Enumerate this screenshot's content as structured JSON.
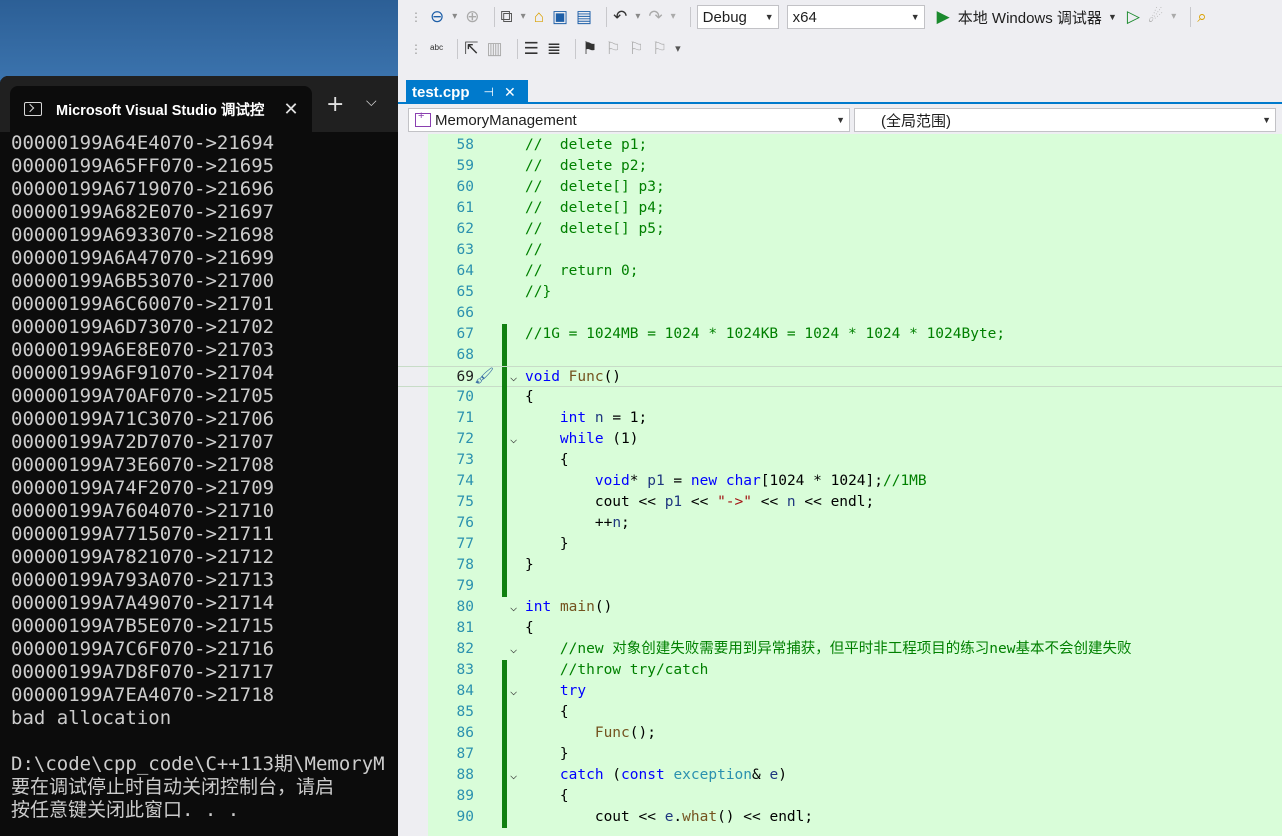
{
  "console": {
    "tab_title": "Microsoft Visual Studio 调试控",
    "new_tab_label": "+",
    "dropdown_label": "⌵",
    "close_label": "✕",
    "lines": [
      "00000199A64E4070->21694",
      "00000199A65FF070->21695",
      "00000199A6719070->21696",
      "00000199A682E070->21697",
      "00000199A6933070->21698",
      "00000199A6A47070->21699",
      "00000199A6B53070->21700",
      "00000199A6C60070->21701",
      "00000199A6D73070->21702",
      "00000199A6E8E070->21703",
      "00000199A6F91070->21704",
      "00000199A70AF070->21705",
      "00000199A71C3070->21706",
      "00000199A72D7070->21707",
      "00000199A73E6070->21708",
      "00000199A74F2070->21709",
      "00000199A7604070->21710",
      "00000199A7715070->21711",
      "00000199A7821070->21712",
      "00000199A793A070->21713",
      "00000199A7A49070->21714",
      "00000199A7B5E070->21715",
      "00000199A7C6F070->21716",
      "00000199A7D8F070->21717",
      "00000199A7EA4070->21718",
      "bad allocation",
      "",
      "D:\\code\\cpp_code\\C++113期\\MemoryM",
      "要在调试停止时自动关闭控制台，请启",
      "按任意键关闭此窗口. . ."
    ]
  },
  "toolbar": {
    "config": "Debug",
    "platform": "x64",
    "run_label": "本地 Windows 调试器"
  },
  "tab": {
    "file_name": "test.cpp",
    "pin": "⊣",
    "close": "✕"
  },
  "nav": {
    "project": "MemoryManagement",
    "scope": "(全局范围)"
  },
  "code": {
    "current_line": 69,
    "lines": [
      {
        "n": 58,
        "text": "//  delete p1;"
      },
      {
        "n": 59,
        "text": "//  delete p2;"
      },
      {
        "n": 60,
        "text": "//  delete[] p3;"
      },
      {
        "n": 61,
        "text": "//  delete[] p4;"
      },
      {
        "n": 62,
        "text": "//  delete[] p5;"
      },
      {
        "n": 63,
        "text": "//"
      },
      {
        "n": 64,
        "text": "//  return 0;"
      },
      {
        "n": 65,
        "text": "//}"
      },
      {
        "n": 66,
        "text": ""
      },
      {
        "n": 67,
        "text": "//1G = 1024MB = 1024 * 1024KB = 1024 * 1024 * 1024Byte;"
      },
      {
        "n": 68,
        "text": ""
      },
      {
        "n": 69,
        "text": "void Func()"
      },
      {
        "n": 70,
        "text": "{"
      },
      {
        "n": 71,
        "text": "    int n = 1;"
      },
      {
        "n": 72,
        "text": "    while (1)"
      },
      {
        "n": 73,
        "text": "    {"
      },
      {
        "n": 74,
        "text": "        void* p1 = new char[1024 * 1024];//1MB"
      },
      {
        "n": 75,
        "text": "        cout << p1 << \"->\" << n << endl;"
      },
      {
        "n": 76,
        "text": "        ++n;"
      },
      {
        "n": 77,
        "text": "    }"
      },
      {
        "n": 78,
        "text": "}"
      },
      {
        "n": 79,
        "text": ""
      },
      {
        "n": 80,
        "text": "int main()"
      },
      {
        "n": 81,
        "text": "{"
      },
      {
        "n": 82,
        "text": "    //new 对象创建失败需要用到异常捕获，但平时非工程项目的练习new基本不会创建失败"
      },
      {
        "n": 83,
        "text": "    //throw try/catch"
      },
      {
        "n": 84,
        "text": "    try"
      },
      {
        "n": 85,
        "text": "    {"
      },
      {
        "n": 86,
        "text": "        Func();"
      },
      {
        "n": 87,
        "text": "    }"
      },
      {
        "n": 88,
        "text": "    catch (const exception& e)"
      },
      {
        "n": 89,
        "text": "    {"
      },
      {
        "n": 90,
        "text": "        cout << e.what() << endl;"
      }
    ]
  }
}
